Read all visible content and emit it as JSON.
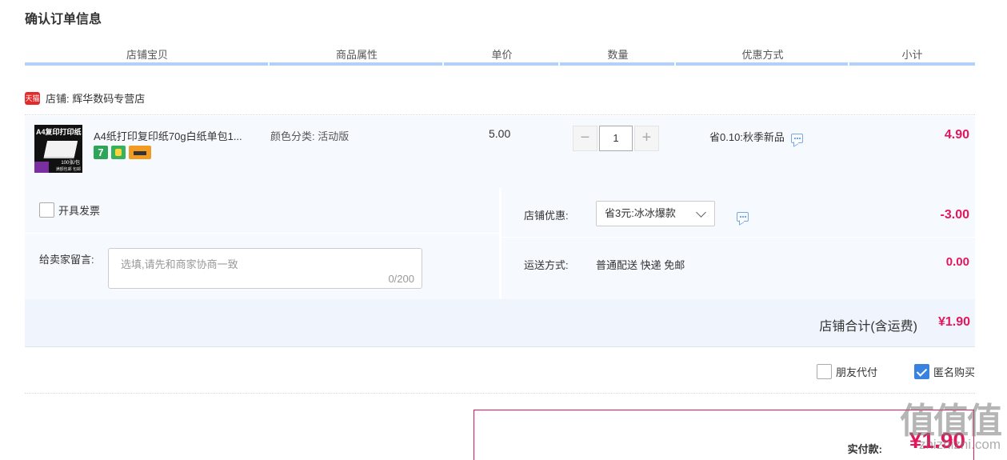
{
  "page": {
    "title": "确认订单信息"
  },
  "table": {
    "headers": [
      "店铺宝贝",
      "商品属性",
      "单价",
      "数量",
      "优惠方式",
      "小计"
    ]
  },
  "shop": {
    "tag": "天猫",
    "label": "店铺: 辉华数码专营店"
  },
  "item": {
    "thumb_title": "A4复印打印纸",
    "thumb_note": "100张/包",
    "thumb_note2": "满额包邮 包邮",
    "name": "A4纸打印复印纸70g白纸单包1...",
    "attribute": "颜色分类:  活动版",
    "price": "5.00",
    "quantity": "1",
    "minus": "−",
    "plus": "+",
    "discount": "省0.10:秋季新品",
    "subtotal": "4.90",
    "service_7": "7"
  },
  "invoice": {
    "label": "开具发票",
    "checked": false
  },
  "note": {
    "label": "给卖家留言:",
    "placeholder": "选填,请先和商家协商一致",
    "counter": "0/200"
  },
  "coupon": {
    "label": "店铺优惠:",
    "selected": "省3元:冰冰爆款",
    "amount": "-3.00"
  },
  "shipping": {
    "label": "运送方式:",
    "method": "普通配送 快递 免邮",
    "amount": "0.00"
  },
  "shop_total": {
    "label": "店铺合计(含运费)",
    "value": "¥1.90"
  },
  "options": {
    "friend_pay": "朋友代付",
    "anonymous": "匿名购买"
  },
  "payment": {
    "label": "实付款:",
    "value": "¥1.90"
  },
  "watermark": {
    "big": "值值值",
    "small": "zhizhizhi.com"
  },
  "colors": {
    "accent": "#e3165b",
    "header_underline": "#b2d1f7",
    "row_bg": "#f6f9fe",
    "check_blue": "#3a82e0"
  }
}
